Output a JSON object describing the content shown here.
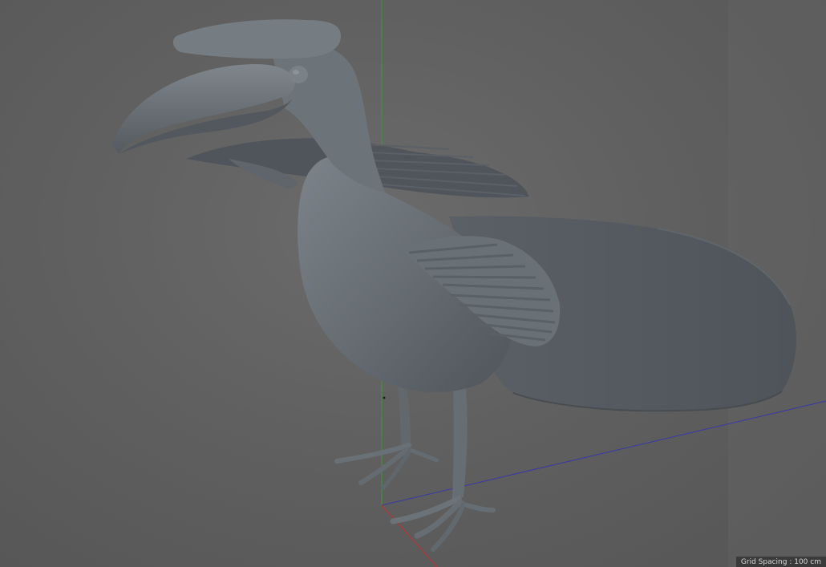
{
  "viewport": {
    "name": "3D perspective viewport",
    "background_color": "#606060",
    "object": "hornbill-bird-model",
    "model_color": "#6a7177",
    "axes": {
      "x_color": "#c03030",
      "y_color": "#3a9a3a",
      "z_color": "#3838a8"
    }
  },
  "status": {
    "grid_spacing_text": "Grid Spacing : 100 cm"
  }
}
